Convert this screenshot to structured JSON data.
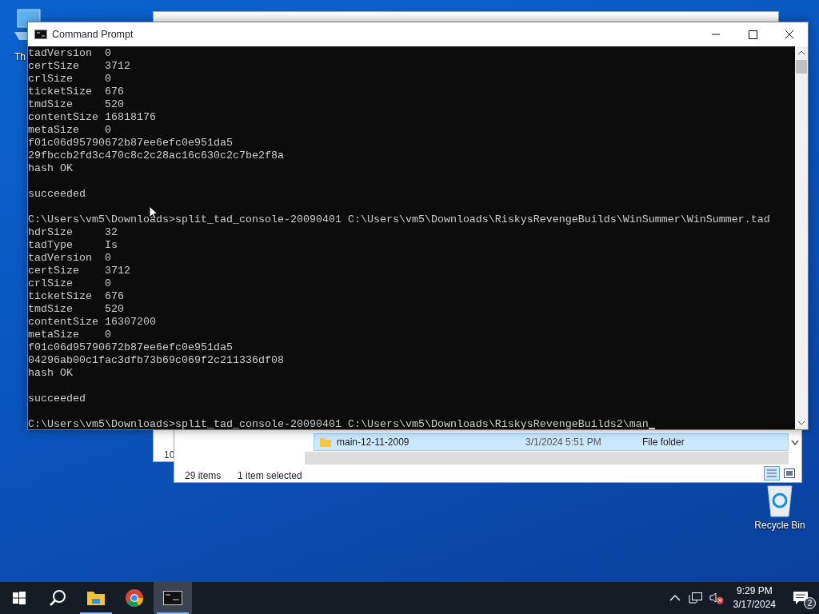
{
  "desktop": {
    "icons": [
      {
        "kind": "computer",
        "label": "Th"
      },
      {
        "kind": "recycle",
        "label": "Recycle Bin"
      }
    ]
  },
  "explorer": {
    "left_text": "10",
    "row": {
      "name": "main-12-11-2009",
      "date_modified": "3/1/2024 5:51 PM",
      "type": "File folder",
      "selected": true
    },
    "status": {
      "items": "29 items",
      "selection": "1 item selected"
    }
  },
  "console": {
    "title": "Command Prompt",
    "blocks": [
      [
        "tadVersion  0",
        "certSize    3712",
        "crlSize     0",
        "ticketSize  676",
        "tmdSize     520",
        "contentSize 16818176",
        "metaSize    0",
        "f01c06d95790672b87ee6efc0e951da5",
        "29fbccb2fd3c470c8c2c28ac16c630c2c7be2f8a",
        "hash OK"
      ],
      [
        "succeeded"
      ],
      [
        "C:\\Users\\vm5\\Downloads>split_tad_console-20090401 C:\\Users\\vm5\\Downloads\\RiskysRevengeBuilds\\WinSummer\\WinSummer.tad",
        "hdrSize     32",
        "tadType     Is",
        "tadVersion  0",
        "certSize    3712",
        "crlSize     0",
        "ticketSize  676",
        "tmdSize     520",
        "contentSize 16307200",
        "metaSize    0",
        "f01c06d95790672b87ee6efc0e951da5",
        "04296ab00c1fac3dfb73b69c069f2c211336df08",
        "hash OK"
      ],
      [
        "succeeded"
      ],
      [
        "C:\\Users\\vm5\\Downloads>split_tad_console-20090401 C:\\Users\\vm5\\Downloads\\RiskysRevengeBuilds2\\man"
      ]
    ]
  },
  "taskbar": {
    "apps": [
      {
        "kind": "start",
        "running": false,
        "selected": false
      },
      {
        "kind": "search",
        "running": false,
        "selected": false
      },
      {
        "kind": "explorer",
        "running": true,
        "selected": false
      },
      {
        "kind": "chrome",
        "running": false,
        "selected": false
      },
      {
        "kind": "cmd",
        "running": true,
        "selected": true
      }
    ],
    "clock": {
      "time": "9:29 PM",
      "date": "3/17/2024"
    },
    "notifications": {
      "count": "2"
    }
  }
}
